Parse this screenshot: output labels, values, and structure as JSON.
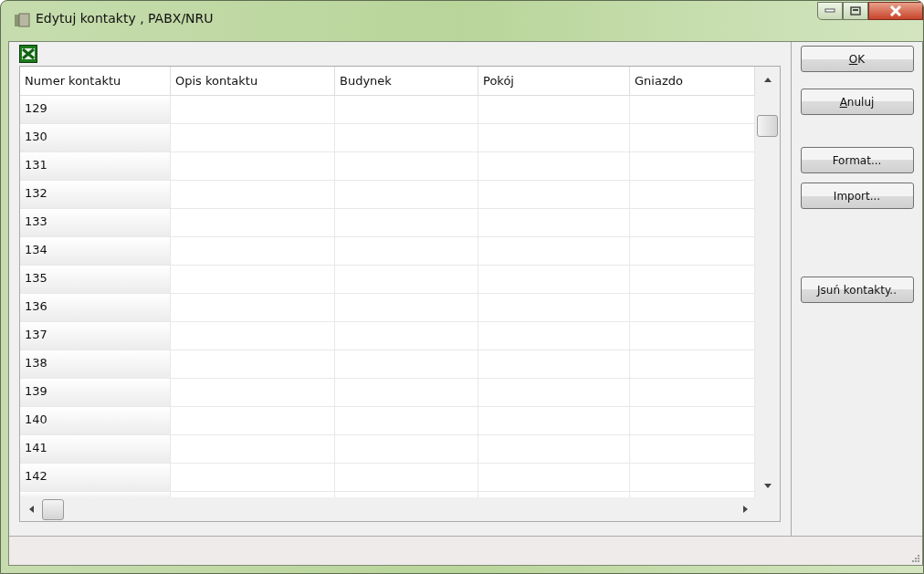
{
  "window": {
    "title": "Edytuj kontakty , PABX/NRU"
  },
  "table": {
    "columns": [
      "Numer kontaktu",
      "Opis kontaktu",
      "Budynek",
      "Pokój",
      "Gniazdo"
    ],
    "rows": [
      [
        "129"
      ],
      [
        "130"
      ],
      [
        "131"
      ],
      [
        "132"
      ],
      [
        "133"
      ],
      [
        "134"
      ],
      [
        "135"
      ],
      [
        "136"
      ],
      [
        "137"
      ],
      [
        "138"
      ],
      [
        "139"
      ],
      [
        "140"
      ],
      [
        "141"
      ],
      [
        "142"
      ]
    ]
  },
  "buttons": [
    {
      "key": "O",
      "rest": "K",
      "kind": "top"
    },
    {
      "key": "A",
      "rest": "nuluj",
      "kind": "top"
    },
    {
      "rest": "Format...",
      "kind": "mid"
    },
    {
      "rest": "Import...",
      "kind": "mid"
    },
    {
      "rest": "Jsuń kontakty..",
      "kind": "bottom"
    }
  ]
}
